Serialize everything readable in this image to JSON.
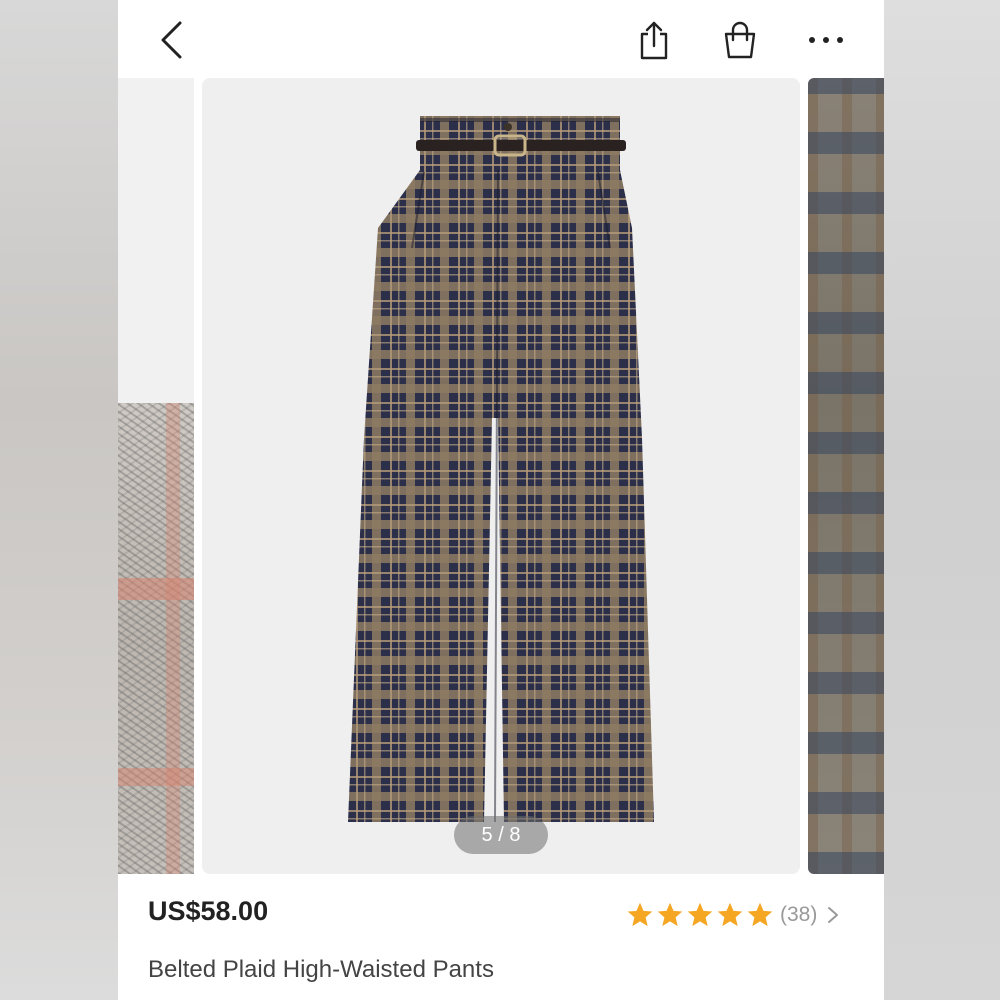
{
  "gallery": {
    "counter": "5 / 8",
    "current_index": 5,
    "total": 8
  },
  "product": {
    "price": "US$58.00",
    "title": "Belted Plaid High-Waisted Pants",
    "rating_stars": 5,
    "review_count": "(38)"
  },
  "colors": {
    "star": "#f5a623",
    "plaid_navy": "#2b2f4a",
    "plaid_tan": "#9c8468"
  },
  "icons": [
    "back-icon",
    "share-icon",
    "shopping-bag-icon",
    "more-icon",
    "star-icon",
    "chevron-right-icon"
  ]
}
